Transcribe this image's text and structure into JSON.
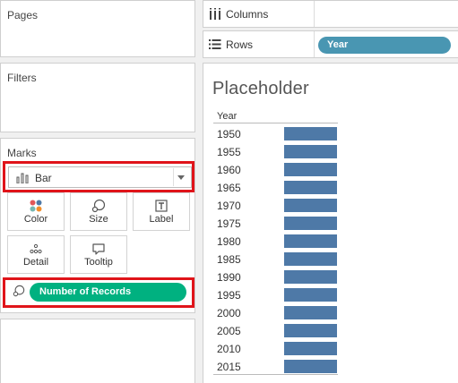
{
  "pages_panel": {
    "title": "Pages"
  },
  "filters_panel": {
    "title": "Filters"
  },
  "marks_panel": {
    "title": "Marks",
    "mark_type": "Bar",
    "buttons": [
      {
        "label": "Color",
        "icon": "color-icon"
      },
      {
        "label": "Size",
        "icon": "size-icon"
      },
      {
        "label": "Label",
        "icon": "label-icon"
      },
      {
        "label": "Detail",
        "icon": "detail-icon"
      },
      {
        "label": "Tooltip",
        "icon": "tooltip-icon"
      }
    ],
    "size_pill": {
      "label": "Number of Records",
      "icon": "size-icon",
      "color": "#00b180"
    }
  },
  "shelves": {
    "columns": {
      "label": "Columns",
      "icon": "columns-icon"
    },
    "rows": {
      "label": "Rows",
      "icon": "rows-icon",
      "pill": "Year",
      "pill_color": "#4996b2"
    }
  },
  "view": {
    "title": "Placeholder",
    "header": "Year",
    "bar_color": "#4e79a7",
    "rows": [
      "1950",
      "1955",
      "1960",
      "1965",
      "1970",
      "1975",
      "1980",
      "1985",
      "1990",
      "1995",
      "2000",
      "2005",
      "2010",
      "2015"
    ]
  },
  "highlight_color": "#e0141a"
}
